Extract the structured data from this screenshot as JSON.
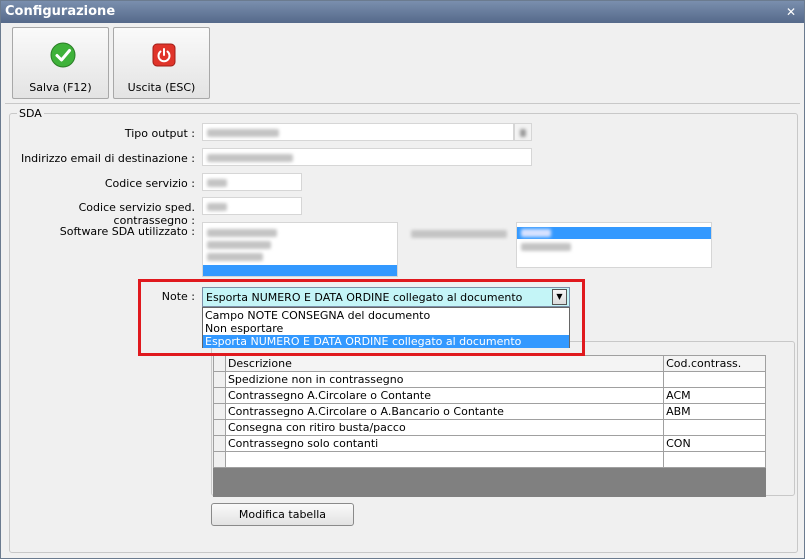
{
  "window": {
    "title": "Configurazione"
  },
  "toolbar": {
    "save_label": "Salva (F12)",
    "exit_label": "Uscita (ESC)"
  },
  "group": {
    "legend": "SDA",
    "labels": {
      "tipo_output": "Tipo output :",
      "email": "Indirizzo email di destinazione :",
      "codice_servizio": "Codice servizio :",
      "codice_contrassegno": "Codice servizio sped. contrassegno :",
      "software": "Software SDA utilizzato :",
      "note": "Note :"
    }
  },
  "note": {
    "selected": "Esporta NUMERO E DATA ORDINE collegato al documento",
    "options": [
      "Campo NOTE CONSEGNA del documento",
      "Non esportare",
      "Esporta NUMERO E DATA ORDINE collegato al documento"
    ]
  },
  "table": {
    "columns": [
      "Descrizione",
      "Cod.contrass."
    ],
    "rows": [
      [
        "Spedizione non in contrassegno",
        ""
      ],
      [
        "Contrassegno A.Circolare o Contante",
        "ACM"
      ],
      [
        "Contrassegno A.Circolare o A.Bancario o Contante",
        "ABM"
      ],
      [
        "Consegna con ritiro busta/pacco",
        ""
      ],
      [
        "Contrassegno solo contanti",
        "CON"
      ],
      [
        "",
        ""
      ]
    ],
    "edit_button": "Modifica tabella"
  },
  "colors": {
    "accent": "#3399ff",
    "highlight_frame": "#e0191e",
    "combo_bg": "#c4f5f7"
  },
  "icons": {
    "save": "check-icon",
    "exit": "power-icon",
    "close": "close-icon",
    "dropdown": "chevron-down-icon"
  }
}
